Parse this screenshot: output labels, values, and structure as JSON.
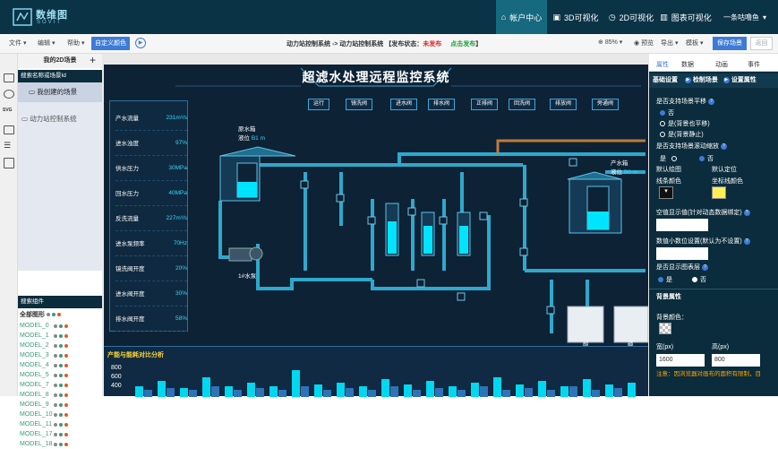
{
  "brand": {
    "name_cn": "数维图",
    "name_en": "SOVIT"
  },
  "topnav": [
    {
      "label": "帐户中心",
      "icon": "account-icon"
    },
    {
      "label": "3D可视化",
      "icon": "cube-icon"
    },
    {
      "label": "2D可视化",
      "icon": "clock-icon"
    },
    {
      "label": "图表可视化",
      "icon": "bar-chart-icon"
    }
  ],
  "user": {
    "label": "一条咕噜鱼",
    "icon": "chevron-down-icon"
  },
  "toolbar": {
    "menus": [
      "文件",
      "编辑",
      "帮助"
    ],
    "custom_color": "自定义颜色",
    "breadcrumb_prefix": "动力站控制系统 -> 动力站控制系统 【发布状态：",
    "publish_status": "未发布",
    "publish_link": "点击发布",
    "breadcrumb_suffix": "】",
    "zoom": "85%",
    "preview": "预览",
    "export": "导出",
    "template": "模板",
    "save": "保存场景",
    "back": "返回"
  },
  "left_panel": {
    "title": "我的2D场景",
    "search_placeholder": "搜索名称或场景Id",
    "my_scenes": "我创建的场景",
    "scene_item": "动力站控制系统",
    "component_search": "搜索组件",
    "all_shapes": "全部图形",
    "models": [
      "MODEL_0",
      "MODEL_1",
      "MODEL_2",
      "MODEL_3",
      "MODEL_4",
      "MODEL_5",
      "MODEL_7",
      "MODEL_8",
      "MODEL_9",
      "MODEL_10",
      "MODEL_11",
      "MODEL_17",
      "MODEL_18"
    ]
  },
  "scene": {
    "title": "超滤水处理远程监控系统",
    "metrics": [
      {
        "label": "产水流量",
        "value": "231m³/s"
      },
      {
        "label": "进水浊度",
        "value": "97%"
      },
      {
        "label": "供水压力",
        "value": "30MPa"
      },
      {
        "label": "回水压力",
        "value": "40MPa"
      },
      {
        "label": "反洗流量",
        "value": "227m³/s"
      },
      {
        "label": "进水泵频率",
        "value": "70Hz"
      },
      {
        "label": "镜洗阀开度",
        "value": "20%"
      },
      {
        "label": "进水阀开度",
        "value": "30%"
      },
      {
        "label": "排水阀开度",
        "value": "58%"
      }
    ],
    "valves": [
      "运行",
      "镜洗阀",
      "进水阀",
      "排水阀",
      "正排阀",
      "回洗阀",
      "排放阀",
      "旁通阀"
    ],
    "raw_tank": {
      "name": "原水箱",
      "level_label": "液位",
      "level_value": "B1",
      "unit": "m"
    },
    "product_tank": {
      "name": "产水箱",
      "level_label": "液位",
      "level_value": "B0",
      "unit": "m"
    },
    "pump": "1#水泵",
    "acid": "酸",
    "alkali": "碱",
    "energy_title": "产能与能耗对比分析",
    "energy_axis": [
      "800",
      "600",
      "400"
    ]
  },
  "right_panel": {
    "tabs": [
      "属性",
      "数据",
      "动画",
      "事件"
    ],
    "basic": "基础设置",
    "detect": "检制场景",
    "set_attr": "设置属性",
    "pan_label": "是否支持场景平移",
    "pan_opts": [
      "否",
      "是(背景也平移)",
      "是(背景静止)"
    ],
    "zoom_label": "是否支持场景滚动缩放",
    "zoom_opts": [
      "是",
      "否"
    ],
    "default_draw": "默认绘图",
    "default_locate": "默认定位",
    "line_color": "线条颜色",
    "coord_color": "坐标线颜色",
    "empty_label": "空值显示值(针对动态数据绑定)",
    "decimal_label": "数值小数位设置(默认为不设置)",
    "show_layer": "是否显示图表层",
    "layer_opts": [
      "是",
      "否"
    ],
    "bg_section": "背景属性",
    "bg_color": "背景颜色：",
    "width_label": "宽(px)",
    "height_label": "高(px)",
    "width_value": "1600",
    "height_value": "800",
    "warning": "注意：因浏览器对画布的面积有限制，目"
  },
  "colors": {
    "accent": "#3d7bd6",
    "topbar": "#0b3346",
    "scene_bg": "#0d2235",
    "cyan": "#35d6ff",
    "pipe": "#2ea8cc"
  }
}
